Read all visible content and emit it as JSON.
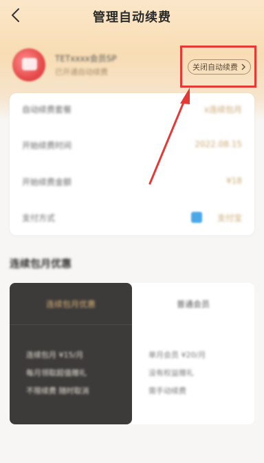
{
  "nav": {
    "title": "管理自动续费"
  },
  "member": {
    "name": "TETxxxx会员SP",
    "subtitle": "已开通自动续费"
  },
  "close_button": {
    "label": "关闭自动续费"
  },
  "details": [
    {
      "label": "自动续费套餐",
      "value": "x连续包月"
    },
    {
      "label": "开始续费时间",
      "value": "2022.08.15"
    },
    {
      "label": "开始续费金额",
      "value": "¥18"
    },
    {
      "label": "支付方式",
      "value": "支付宝"
    }
  ],
  "section": {
    "title": "连续包月优惠"
  },
  "compare": {
    "left": {
      "title": "连续包月优惠",
      "lines": [
        "连续包月 ¥15/月",
        "每月领取超值赠礼",
        "不限续费 随时取消"
      ]
    },
    "right": {
      "title": "普通会员",
      "lines": [
        "单月会员 ¥20/月",
        "没有权益赠礼",
        "需手动续费"
      ]
    }
  },
  "colors": {
    "highlight": "#e53935",
    "accent": "#c9a66e"
  }
}
